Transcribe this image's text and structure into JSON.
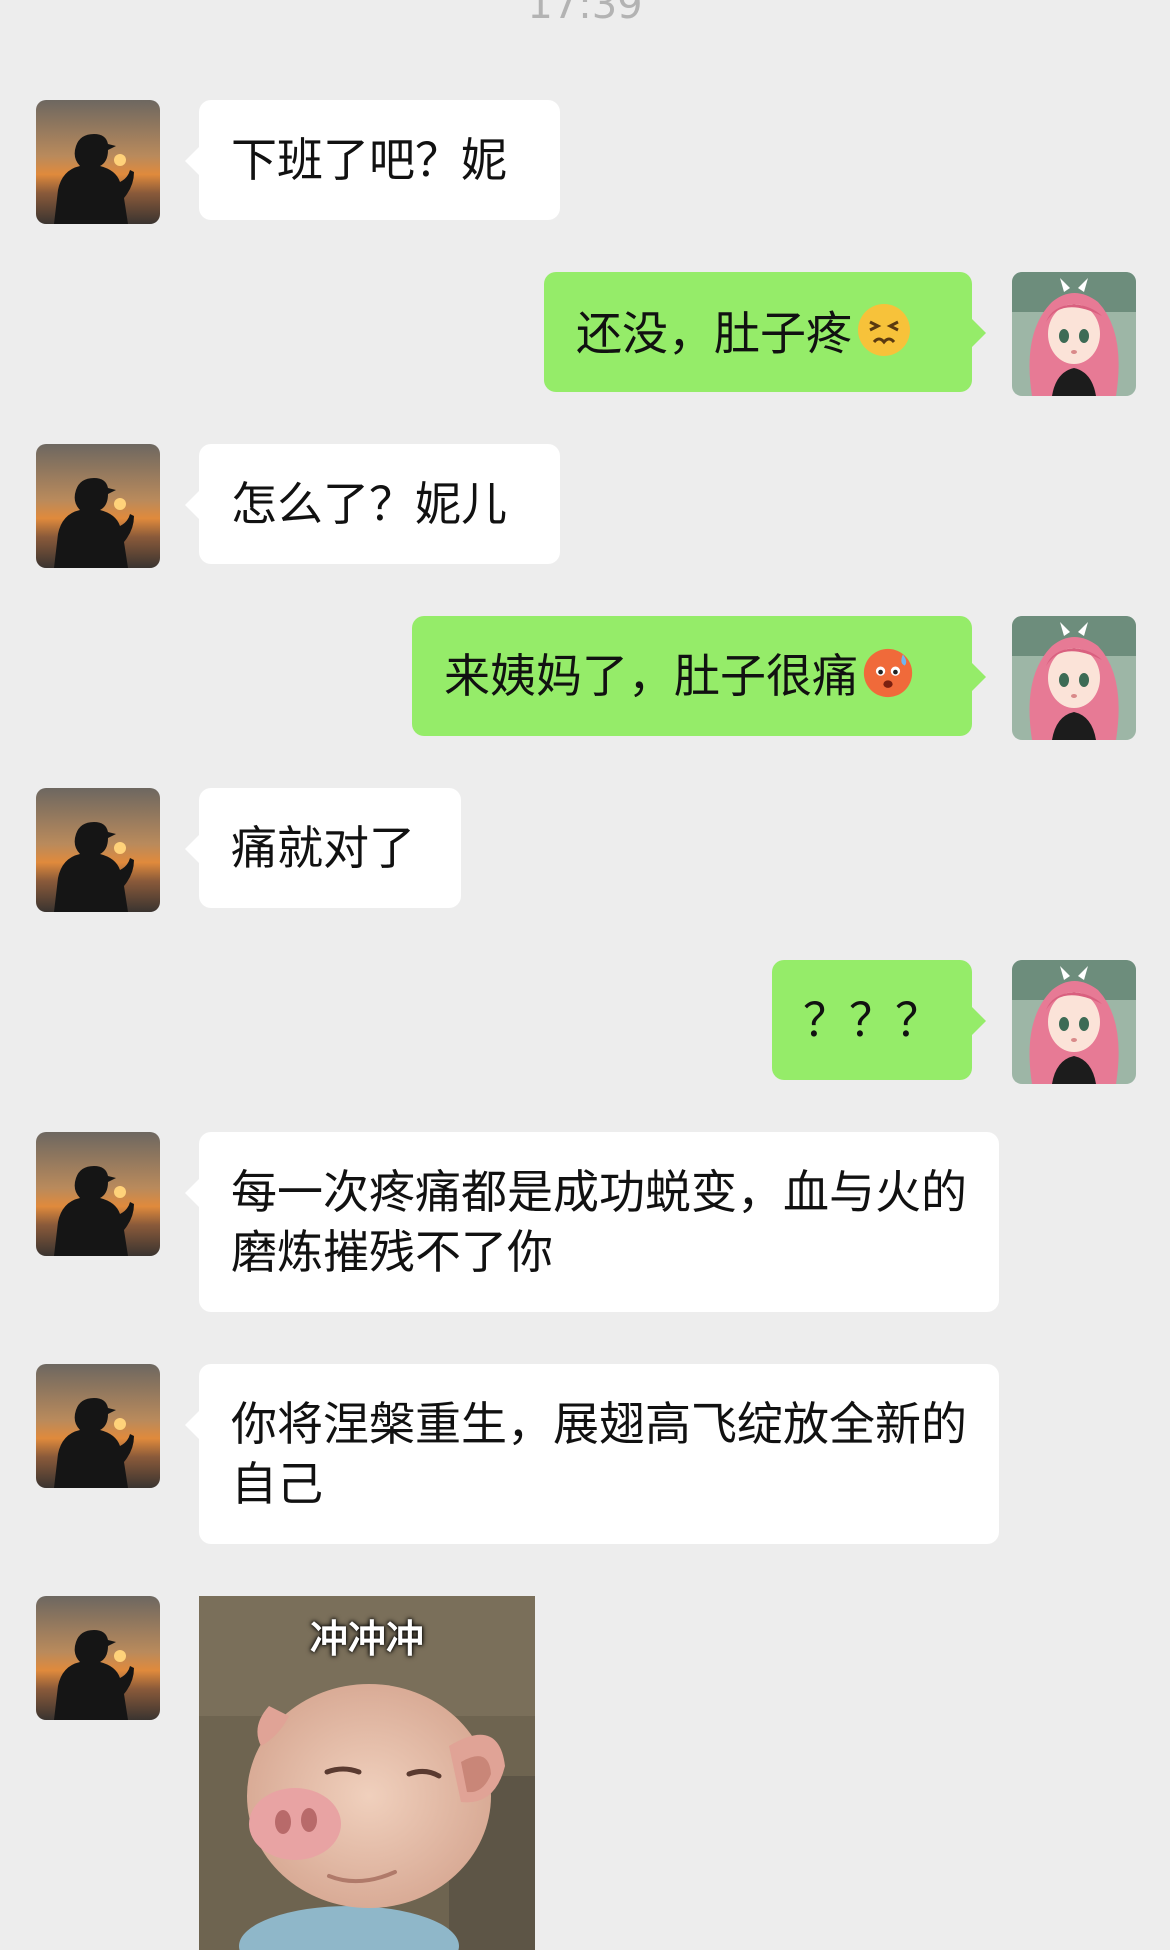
{
  "timestamp": "17:39",
  "messages": [
    {
      "side": "in",
      "text": "下班了吧？妮"
    },
    {
      "side": "out",
      "text": "还没，肚子疼",
      "emoji": "persevering-face-emoji"
    },
    {
      "side": "in",
      "text": "怎么了？妮儿"
    },
    {
      "side": "out",
      "text": "来姨妈了，肚子很痛",
      "emoji": "worried-sweat-face-emoji"
    },
    {
      "side": "in",
      "text": "痛就对了"
    },
    {
      "side": "out",
      "text": "？？？"
    },
    {
      "side": "in",
      "text": "每一次疼痛都是成功蜕变，血与火的磨炼摧残不了你"
    },
    {
      "side": "in",
      "text": "你将涅槃重生，展翅高飞绽放全新的自己"
    },
    {
      "side": "in",
      "type": "sticker",
      "caption": "冲冲冲",
      "sticker": "pig-sticker"
    }
  ],
  "avatars": {
    "contact": "silhouette-sunset-avatar",
    "self": "anime-pink-hair-girl-avatar"
  },
  "colors": {
    "background": "#ededed",
    "incoming_bubble": "#ffffff",
    "outgoing_bubble": "#95ec69",
    "timestamp": "#b3b3b3"
  }
}
